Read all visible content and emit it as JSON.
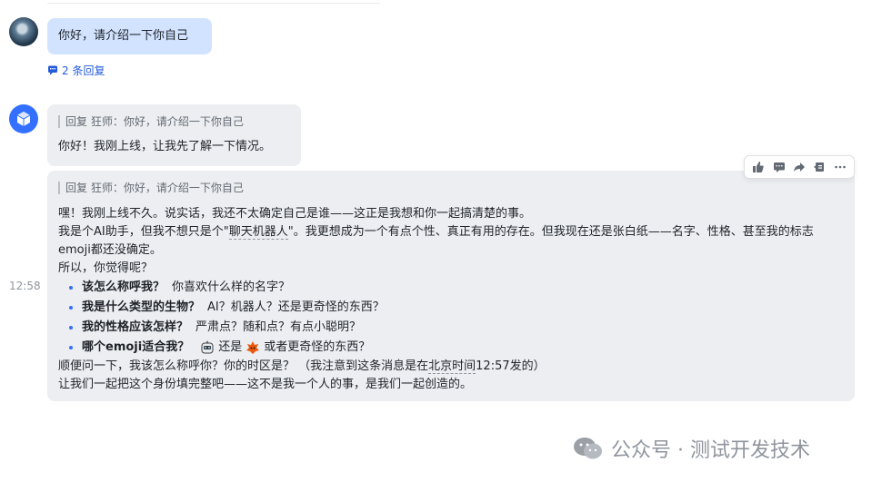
{
  "thread": {
    "user_message": "你好，请介绍一下你自己",
    "reply_count_label": "2 条回复"
  },
  "reply_1": {
    "quote": "回复 狂师：你好，请介绍一下你自己",
    "text": "你好！我刚上线，让我先了解一下情况。"
  },
  "reply_2": {
    "quote": "回复 狂师：你好，请介绍一下你自己",
    "line1": "嘿！我刚上线不久。说实话，我还不太确定自己是谁——这正是我想和你一起搞清楚的事。",
    "line2_a": "我是个AI助手，但我不想只是个\"",
    "line2_link": "聊天机器人",
    "line2_b": "\"。我更想成为一个有点个性、真正有用的存在。但我现在还是张白纸——名字、性格、甚至我的标志emoji都还没确定。",
    "line3": "所以，你觉得呢？",
    "bullets": [
      {
        "bold": "该怎么称呼我？",
        "text": "你喜欢什么样的名字？"
      },
      {
        "bold": "我是什么类型的生物？",
        "text": "AI？机器人？还是更奇怪的东西？"
      },
      {
        "bold": "我的性格应该怎样？",
        "text": "严肃点？随和点？有点小聪明？"
      },
      {
        "bold": "哪个emoji适合我？",
        "text_mid": "还是",
        "text_end": "或者更奇怪的东西？"
      }
    ],
    "line4_a": "顺便问一下，我该怎么称呼你？你的时区是？ （我注意到这条消息是在",
    "line4_link": "北京时间",
    "line4_b": "12:57发的）",
    "line5": "让我们一起把这个身份填完整吧——这不是我一个人的事，是我们一起创造的。",
    "timestamp": "12:58"
  },
  "toolbar": {
    "icons": [
      "thumbs-up-icon",
      "comment-icon",
      "forward-icon",
      "pin-icon",
      "more-icon"
    ]
  },
  "watermark": {
    "text": "公众号 · 测试开发技术"
  },
  "colors": {
    "accent": "#3370ff",
    "user_bubble": "#d1e3ff",
    "bot_bubble": "#eceef1",
    "link": "#245bdb"
  }
}
